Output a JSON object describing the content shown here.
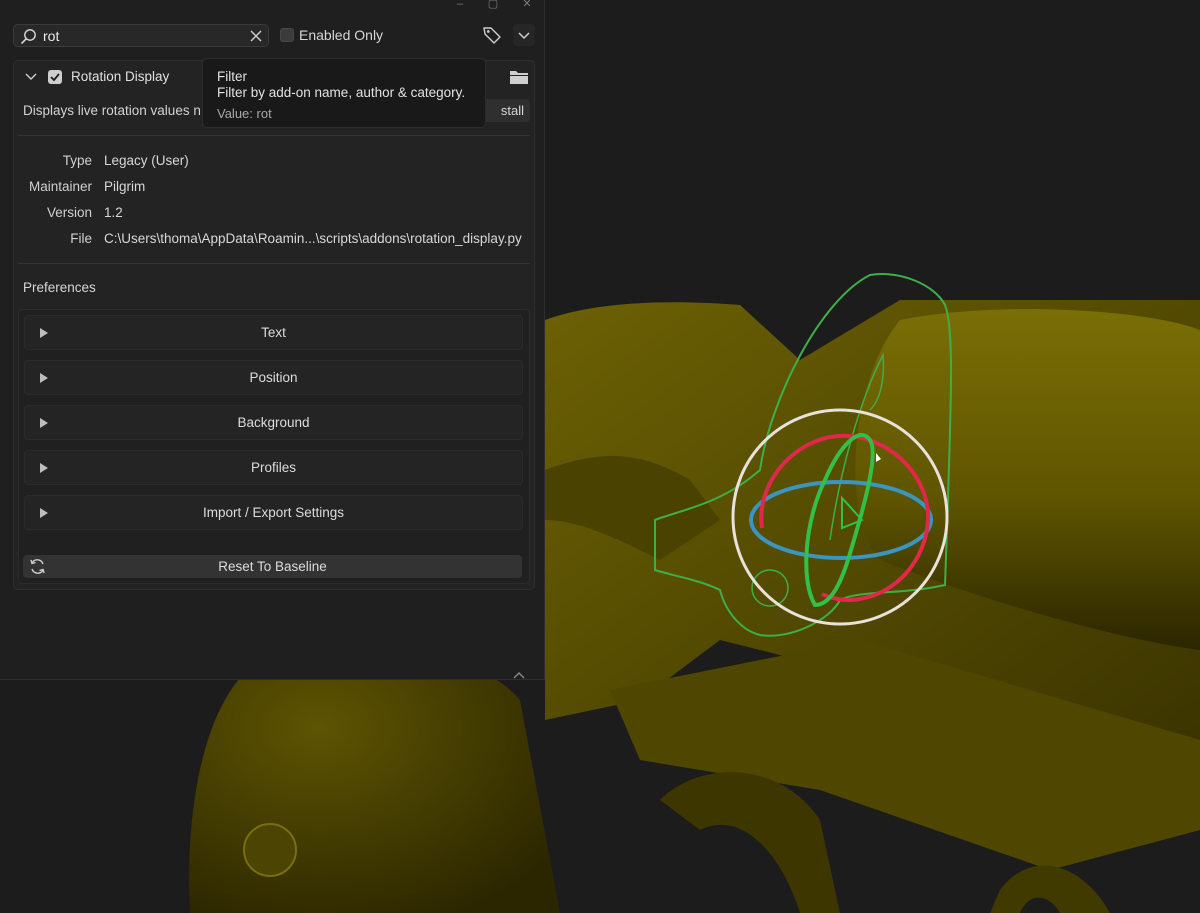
{
  "window": {
    "controls": [
      "–",
      "▢",
      "✕"
    ]
  },
  "search": {
    "value": "rot",
    "placeholder": ""
  },
  "filter": {
    "enabled_only_label": "Enabled Only"
  },
  "addon": {
    "name": "Rotation Display",
    "enabled": true,
    "description": "Displays live rotation values n",
    "uninstall_label": "stall",
    "info": [
      {
        "key": "Type",
        "value": "Legacy (User)"
      },
      {
        "key": "Maintainer",
        "value": "Pilgrim"
      },
      {
        "key": "Version",
        "value": "1.2"
      },
      {
        "key": "File",
        "value": "C:\\Users\\thoma\\AppData\\Roamin...\\scripts\\addons\\rotation_display.py"
      }
    ],
    "preferences_label": "Preferences",
    "panels": [
      "Text",
      "Position",
      "Background",
      "Profiles",
      "Import / Export Settings"
    ],
    "reset_label": "Reset To Baseline"
  },
  "tooltip": {
    "title": "Filter",
    "description": "Filter by add-on name, author & category.",
    "value": "Value: rot"
  },
  "viewport": {
    "object_color": "#5c5200",
    "gizmo_colors": {
      "x": "#e0284a",
      "y": "#33c04a",
      "z": "#3a95c0",
      "view": "#e8e2da"
    }
  }
}
